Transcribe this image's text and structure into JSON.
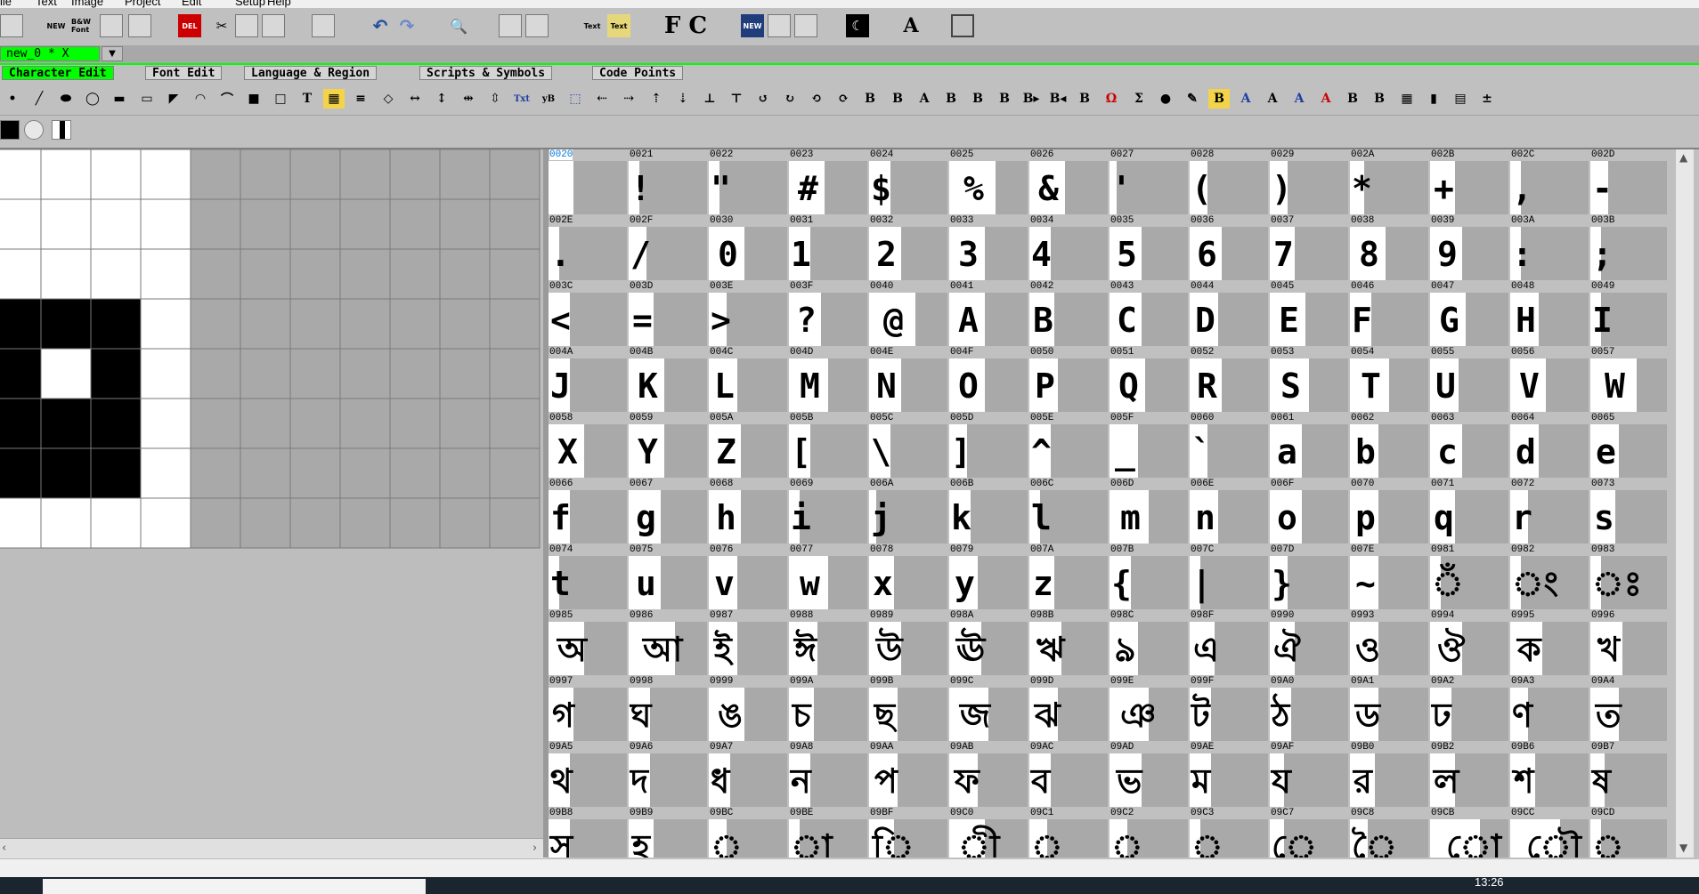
{
  "menu": [
    "ile",
    "Text",
    "Image",
    "Project",
    "Edit",
    "Setup",
    "Help"
  ],
  "toolbar_icons": [
    {
      "name": "open-folder-icon",
      "label": ""
    },
    {
      "name": "new-file-icon",
      "label": "NEW"
    },
    {
      "name": "bw-font-icon",
      "label": "B&W Font"
    },
    {
      "name": "red-book-icon",
      "label": ""
    },
    {
      "name": "green-book-icon",
      "label": ""
    },
    {
      "name": "delete-icon",
      "label": "DEL"
    },
    {
      "name": "cut-icon",
      "label": ""
    },
    {
      "name": "copy-icon",
      "label": ""
    },
    {
      "name": "paste-icon",
      "label": ""
    },
    {
      "name": "clipboard-icon",
      "label": ""
    },
    {
      "name": "undo-icon",
      "label": ""
    },
    {
      "name": "redo-icon",
      "label": ""
    },
    {
      "name": "search-icon",
      "label": ""
    },
    {
      "name": "text-preview-icon",
      "label": ""
    },
    {
      "name": "text-preview-2-icon",
      "label": ""
    },
    {
      "name": "text-box-icon",
      "label": "Text"
    },
    {
      "name": "text-box-yellow-icon",
      "label": "Text"
    },
    {
      "name": "fc-icon",
      "label": "F C"
    },
    {
      "name": "new-font-icon",
      "label": "NEW"
    },
    {
      "name": "red-cube-icon",
      "label": ""
    },
    {
      "name": "green-cube-icon",
      "label": ""
    },
    {
      "name": "moon-icon",
      "label": ""
    },
    {
      "name": "letter-a-icon",
      "label": "A"
    },
    {
      "name": "screen-icon",
      "label": ""
    }
  ],
  "document_tab": {
    "label": "new_0 * X"
  },
  "mode_tabs": [
    "Character Edit",
    "Font Edit",
    "Language & Region",
    "Scripts & Symbols",
    "Code Points"
  ],
  "active_mode": 0,
  "colors": {
    "accent_green": "#00ff00",
    "grid_gray": "#a9a9a9",
    "glyph_white": "#ffffff",
    "ink": "#000000"
  },
  "editor_grid": {
    "cols": 11,
    "rows": 8,
    "white_cols": 4,
    "black_pixels": [
      [
        3,
        0
      ],
      [
        3,
        1
      ],
      [
        3,
        2
      ],
      [
        4,
        0
      ],
      [
        4,
        2
      ],
      [
        5,
        0
      ],
      [
        5,
        1
      ],
      [
        5,
        2
      ],
      [
        6,
        0
      ],
      [
        6,
        1
      ],
      [
        6,
        2
      ]
    ]
  },
  "glyphs": {
    "rows": [
      [
        "0020",
        "0021",
        "0022",
        "0023",
        "0024",
        "0025",
        "0026",
        "0027",
        "0028",
        "0029",
        "002A",
        "002B",
        "002C",
        "002D"
      ],
      [
        "002E",
        "002F",
        "0030",
        "0031",
        "0032",
        "0033",
        "0034",
        "0035",
        "0036",
        "0037",
        "0038",
        "0039",
        "003A",
        "003B"
      ],
      [
        "003C",
        "003D",
        "003E",
        "003F",
        "0040",
        "0041",
        "0042",
        "0043",
        "0044",
        "0045",
        "0046",
        "0047",
        "0048",
        "0049"
      ],
      [
        "004A",
        "004B",
        "004C",
        "004D",
        "004E",
        "004F",
        "0050",
        "0051",
        "0052",
        "0053",
        "0054",
        "0055",
        "0056",
        "0057"
      ],
      [
        "0058",
        "0059",
        "005A",
        "005B",
        "005C",
        "005D",
        "005E",
        "005F",
        "0060",
        "0061",
        "0062",
        "0063",
        "0064",
        "0065"
      ],
      [
        "0066",
        "0067",
        "0068",
        "0069",
        "006A",
        "006B",
        "006C",
        "006D",
        "006E",
        "006F",
        "0070",
        "0071",
        "0072",
        "0073"
      ],
      [
        "0074",
        "0075",
        "0076",
        "0077",
        "0078",
        "0079",
        "007A",
        "007B",
        "007C",
        "007D",
        "007E",
        "0981",
        "0982",
        "0983"
      ],
      [
        "0985",
        "0986",
        "0987",
        "0988",
        "0989",
        "098A",
        "098B",
        "098C",
        "098F",
        "0990",
        "0993",
        "0994",
        "0995",
        "0996"
      ],
      [
        "0997",
        "0998",
        "0999",
        "099A",
        "099B",
        "099C",
        "099D",
        "099E",
        "099F",
        "09A0",
        "09A1",
        "09A2",
        "09A3",
        "09A4"
      ],
      [
        "09A5",
        "09A6",
        "09A7",
        "09A8",
        "09AA",
        "09AB",
        "09AC",
        "09AD",
        "09AE",
        "09AF",
        "09B0",
        "09B2",
        "09B6",
        "09B7"
      ],
      [
        "09B8",
        "09B9",
        "09BC",
        "09BE",
        "09BF",
        "09C0",
        "09C1",
        "09C2",
        "09C3",
        "09C7",
        "09C8",
        "09CB",
        "09CC",
        "09CD"
      ]
    ],
    "chars": [
      [
        " ",
        "!",
        "\"",
        "#",
        "$",
        "%",
        "&",
        "'",
        "(",
        ")",
        "*",
        "+",
        ",",
        "-"
      ],
      [
        ".",
        "/",
        "0",
        "1",
        "2",
        "3",
        "4",
        "5",
        "6",
        "7",
        "8",
        "9",
        ":",
        ";"
      ],
      [
        "<",
        "=",
        ">",
        "?",
        "@",
        "A",
        "B",
        "C",
        "D",
        "E",
        "F",
        "G",
        "H",
        "I"
      ],
      [
        "J",
        "K",
        "L",
        "M",
        "N",
        "O",
        "P",
        "Q",
        "R",
        "S",
        "T",
        "U",
        "V",
        "W"
      ],
      [
        "X",
        "Y",
        "Z",
        "[",
        "\\",
        "]",
        "^",
        "_",
        "`",
        "a",
        "b",
        "c",
        "d",
        "e"
      ],
      [
        "f",
        "g",
        "h",
        "i",
        "j",
        "k",
        "l",
        "m",
        "n",
        "o",
        "p",
        "q",
        "r",
        "s"
      ],
      [
        "t",
        "u",
        "v",
        "w",
        "x",
        "y",
        "z",
        "{",
        "|",
        "}",
        "~",
        "ঁ",
        "ং",
        "ঃ"
      ],
      [
        "অ",
        "আ",
        "ই",
        "ঈ",
        "উ",
        "ঊ",
        "ঋ",
        "ঌ",
        "এ",
        "ঐ",
        "ও",
        "ঔ",
        "ক",
        "খ"
      ],
      [
        "গ",
        "ঘ",
        "ঙ",
        "চ",
        "ছ",
        "জ",
        "ঝ",
        "ঞ",
        "ট",
        "ঠ",
        "ড",
        "ঢ",
        "ণ",
        "ত"
      ],
      [
        "থ",
        "দ",
        "ধ",
        "ন",
        "প",
        "ফ",
        "ব",
        "ভ",
        "ম",
        "য",
        "র",
        "ল",
        "শ",
        "ষ"
      ],
      [
        "স",
        "হ",
        "়",
        "া",
        "ি",
        "ী",
        "ু",
        "ূ",
        "ৃ",
        "ে",
        "ৈ",
        "ো",
        "ৌ",
        "্"
      ]
    ],
    "white_widths": [
      [
        28,
        12,
        12,
        40,
        24,
        52,
        40,
        8,
        20,
        20,
        16,
        28,
        12,
        20
      ],
      [
        12,
        20,
        40,
        24,
        36,
        40,
        24,
        36,
        36,
        28,
        40,
        36,
        12,
        12
      ],
      [
        24,
        28,
        20,
        36,
        52,
        40,
        28,
        36,
        32,
        40,
        24,
        40,
        32,
        12
      ],
      [
        24,
        40,
        32,
        44,
        36,
        40,
        32,
        40,
        36,
        44,
        44,
        32,
        40,
        52
      ],
      [
        40,
        40,
        36,
        24,
        24,
        20,
        24,
        32,
        20,
        36,
        32,
        36,
        32,
        32
      ],
      [
        24,
        36,
        36,
        12,
        8,
        24,
        12,
        44,
        32,
        36,
        32,
        28,
        20,
        28
      ],
      [
        12,
        36,
        32,
        44,
        28,
        32,
        28,
        24,
        12,
        20,
        32,
        12,
        12,
        12
      ],
      [
        40,
        52,
        32,
        32,
        36,
        36,
        36,
        32,
        28,
        28,
        32,
        36,
        36,
        36
      ],
      [
        28,
        24,
        40,
        28,
        32,
        44,
        32,
        44,
        24,
        24,
        32,
        24,
        20,
        32
      ],
      [
        24,
        24,
        24,
        24,
        32,
        32,
        24,
        36,
        24,
        16,
        28,
        28,
        28,
        16
      ],
      [
        24,
        28,
        20,
        12,
        28,
        40,
        20,
        20,
        12,
        16,
        20,
        56,
        56,
        12
      ]
    ],
    "selected": "0020"
  },
  "taskbar": {
    "clock": "13:26"
  }
}
